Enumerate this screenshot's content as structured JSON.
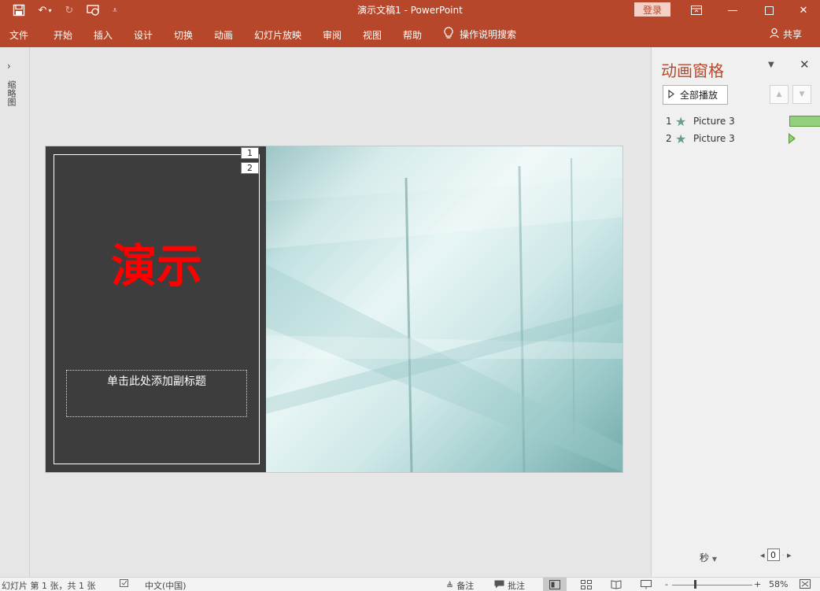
{
  "titlebar": {
    "document_title": "演示文稿1  -  PowerPoint",
    "login_label": "登录"
  },
  "ribbon": {
    "tabs": [
      "文件",
      "开始",
      "插入",
      "设计",
      "切换",
      "动画",
      "幻灯片放映",
      "审阅",
      "视图",
      "帮助"
    ],
    "tellme_label": "操作说明搜索",
    "share_label": "共享"
  },
  "thumbnail_pane": {
    "label": "缩略图"
  },
  "slide": {
    "title": "演示",
    "subtitle_placeholder": "单击此处添加副标题",
    "animation_tags": [
      "1",
      "2"
    ]
  },
  "animation_pane": {
    "title": "动画窗格",
    "play_all_label": "全部播放",
    "items": [
      {
        "number": "1",
        "name": "Picture 3"
      },
      {
        "number": "2",
        "name": "Picture 3"
      }
    ],
    "seconds_label": "秒",
    "timeline_value": "0"
  },
  "statusbar": {
    "slide_info": "幻灯片 第 1 张，共 1 张",
    "language": "中文(中国)",
    "notes_label": "备注",
    "comments_label": "批注",
    "zoom_level": "58%",
    "zoom_minus": "-",
    "zoom_plus": "+"
  },
  "colors": {
    "accent": "#b7472a",
    "slide_background": "#3d3d3d",
    "title_text": "#ff0000",
    "timeline_bar": "#92d07d"
  }
}
